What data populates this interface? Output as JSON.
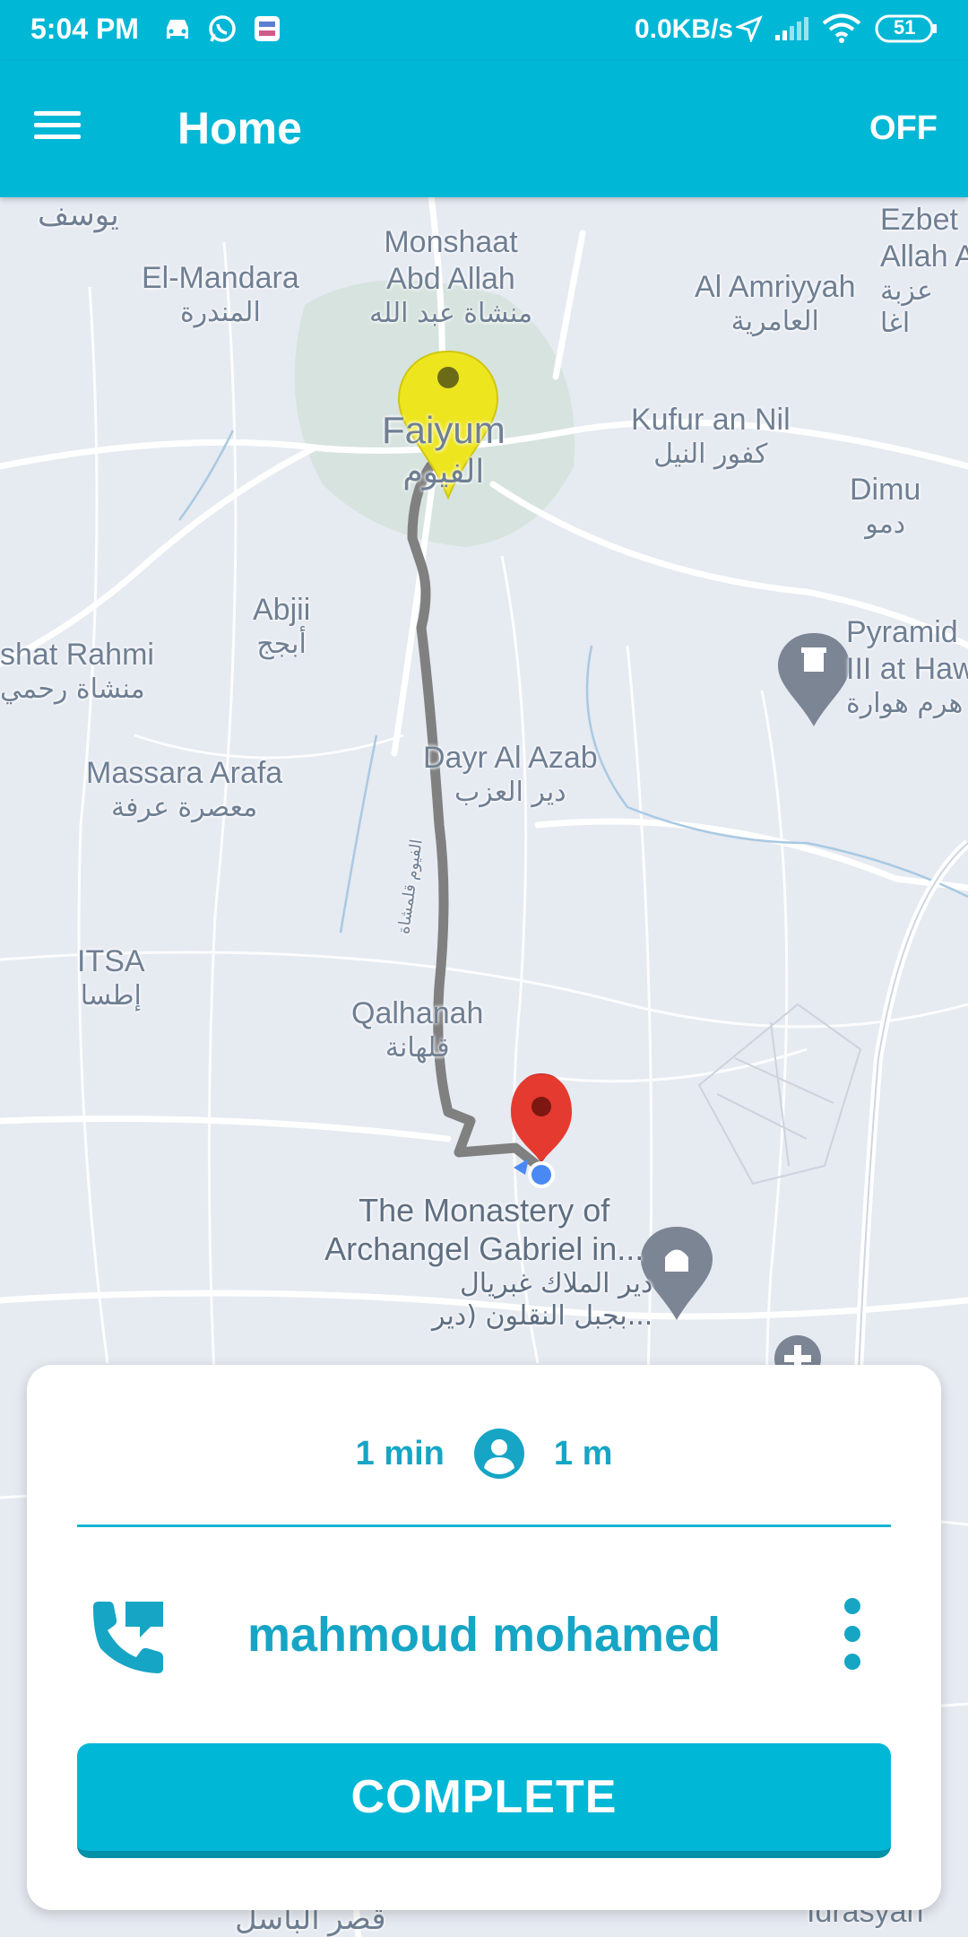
{
  "status_bar": {
    "time": "5:04 PM",
    "network_speed": "0.0KB/s",
    "battery": "51"
  },
  "app_bar": {
    "title": "Home",
    "toggle_label": "OFF"
  },
  "map": {
    "labels": {
      "youssef": "يوسف",
      "el_mandara_en": "El-Mandara",
      "el_mandara_ar": "المندرة",
      "monshaat_en_1": "Monshaat",
      "monshaat_en_2": "Abd Allah",
      "monshaat_ar": "منشاة عبد الله",
      "ezbet_1": "Ezbet",
      "ezbet_2": "Allah A",
      "ezbet_ar_1": "عزبة",
      "ezbet_ar_2": "اغا",
      "amriyyah_en": "Al Amriyyah",
      "amriyyah_ar": "العامرية",
      "faiyum_en": "Faiyum",
      "faiyum_ar": "الفيوم",
      "kufur_en": "Kufur an Nil",
      "kufur_ar": "كفور النيل",
      "dimu_en": "Dimu",
      "dimu_ar": "دمو",
      "abjii_en": "Abjii",
      "abjii_ar": "أبجج",
      "rahmi_en": "shat Rahmi",
      "rahmi_ar": "منشاة رحمي",
      "pyramid_en_1": "Pyramid",
      "pyramid_en_2": "III at Haw",
      "pyramid_ar": "هرم هوارة",
      "massara_en": "Massara Arafa",
      "massara_ar": "معصرة عرفة",
      "dayr_en": "Dayr Al Azab",
      "dayr_ar": "دير العزب",
      "road_ar": "الفيوم قلمشاة",
      "itsa_en": "ITSA",
      "itsa_ar": "إطسا",
      "qalhanah_en": "Qalhanah",
      "qalhanah_ar": "قلهانة",
      "monastery_en_1": "The Monastery of",
      "monastery_en_2": "Archangel Gabriel in...",
      "monastery_ar_1": "دير الملاك غبريال",
      "monastery_ar_2": "بجبل النقلون (دير...",
      "qasr_ar": "قصر الباسل",
      "idrasyan": "Idrasyan"
    }
  },
  "trip_card": {
    "duration": "1 min",
    "distance": "1 m",
    "passenger_name": "mahmoud mohamed",
    "complete_label": "COMPLETE"
  },
  "colors": {
    "primary": "#00b7d6",
    "accent_text": "#16a5c5",
    "route": "#808080",
    "origin_pin": "#ede61f",
    "destination_pin": "#e53a2f"
  }
}
